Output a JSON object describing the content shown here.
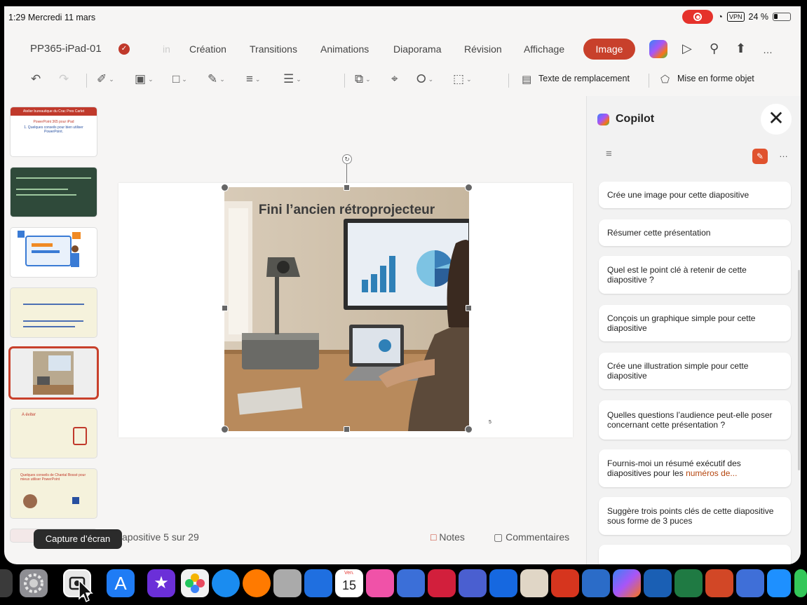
{
  "status_bar": {
    "time": "1:29",
    "date": "Mercredi 11 mars",
    "vpn": "VPN",
    "battery": "24 %"
  },
  "document": {
    "name": "PP365-iPad-01"
  },
  "tabs": [
    {
      "label": "Création"
    },
    {
      "label": "Transitions"
    },
    {
      "label": "Animations"
    },
    {
      "label": "Diaporama"
    },
    {
      "label": "Révision"
    },
    {
      "label": "Affichage"
    },
    {
      "label": "Image"
    }
  ],
  "faded_tab": "in",
  "ribbon": {
    "alt_text": "Texte de remplacement",
    "format_object": "Mise en forme objet"
  },
  "slide": {
    "title": "Fini l’ancien rétroprojecteur",
    "number": "5"
  },
  "bottom": {
    "counter": "apositive 5 sur 29",
    "notes": "Notes",
    "comments": "Commentaires"
  },
  "tooltip": "Capture d’écran",
  "copilot": {
    "title": "Copilot",
    "suggestions": [
      {
        "text": "Crée une image pour cette diapositive"
      },
      {
        "text": "Résumer cette présentation"
      },
      {
        "text": "Quel est le point clé à retenir de cette diapositive ?"
      },
      {
        "text": "Conçois un graphique simple pour cette diapositive"
      },
      {
        "text": "Crée une illustration simple pour cette diapositive"
      },
      {
        "text": "Quelles questions l’audience peut-elle poser concernant cette présentation ?"
      },
      {
        "text": "Fournis-moi un résumé exécutif des diapositives pour les ",
        "highlight": "numéros de..."
      },
      {
        "text": "Suggère trois points clés de cette diapositive sous forme de 3 puces"
      }
    ]
  },
  "dock": {
    "calendar_day": "15",
    "calendar_month": "Ven."
  },
  "thumbnails": {
    "s1_title": "Atelier bureautique du Crac Pres Carlet",
    "s1_sub": "PowerPoint 365 pour iPad",
    "s1_line": "1. Quelques conseils pour bien utiliser PowerPoint.",
    "s6_title": "A éviter",
    "s7_title": "Quelques conseils de Chantal Bossé pour mieux utiliser PowerPoint"
  },
  "colors": {
    "accent": "#c8402b",
    "copilot_highlight": "#b5460f"
  }
}
